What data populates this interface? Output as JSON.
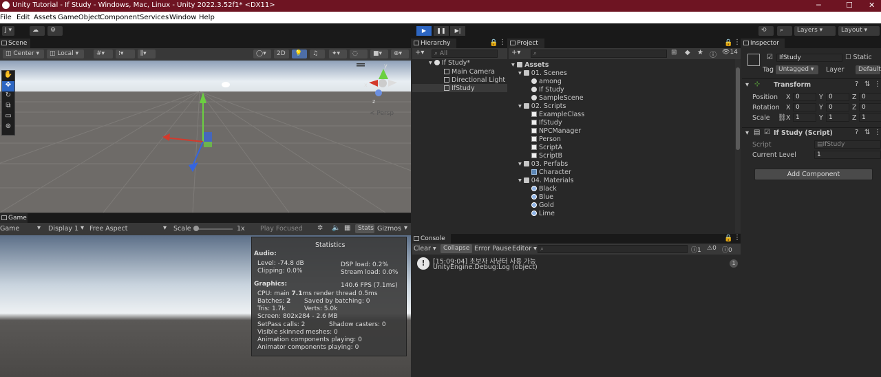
{
  "window": {
    "title": "Unity Tutorial - If Study - Windows, Mac, Linux - Unity 2022.3.52f1* <DX11>",
    "min": "─",
    "max": "☐",
    "close": "✕"
  },
  "menu": [
    "File",
    "Edit",
    "Assets",
    "GameObject",
    "Component",
    "Services",
    "Window",
    "Help"
  ],
  "toolbar": {
    "account": "J ▾",
    "layers": "Layers",
    "layout": "Layout"
  },
  "scene": {
    "tab": "Scene",
    "center": "Center",
    "local": "Local",
    "mode2d": "2D",
    "persp": "< Persp",
    "gizmo_x": "x",
    "gizmo_y": "y",
    "gizmo_z": "z"
  },
  "game": {
    "tab": "Game",
    "mode": "Game",
    "display": "Display 1",
    "aspect": "Free Aspect",
    "scale_label": "Scale",
    "scale_value": "1x",
    "play_focused": "Play Focused",
    "stats": "Stats",
    "gizmos": "Gizmos"
  },
  "stats": {
    "title": "Statistics",
    "audio_header": "Audio:",
    "level": "Level: -74.8 dB",
    "clipping": "Clipping: 0.0%",
    "dsp": "DSP load: 0.2%",
    "stream": "Stream load: 0.0%",
    "graphics_header": "Graphics:",
    "fps": "140.6 FPS (7.1ms)",
    "cpu_pre": "CPU: main ",
    "cpu_main": "7.1",
    "cpu_post": "ms  render thread 0.5ms",
    "batches_pre": "Batches: ",
    "batches_val": "2",
    "saved": "Saved by batching: 0",
    "tris": "Tris: 1.7k",
    "verts": "Verts: 5.0k",
    "screen": "Screen: 802x284 - 2.6 MB",
    "setpass": "SetPass calls: 2",
    "shadow": "Shadow casters: 0",
    "skinned": "Visible skinned meshes: 0",
    "anim": "Animation components playing: 0",
    "animator": "Animator components playing: 0"
  },
  "hierarchy": {
    "tab": "Hierarchy",
    "search": "All",
    "scene": "If Study*",
    "items": [
      "Main Camera",
      "Directional Light",
      "IfStudy"
    ]
  },
  "project": {
    "tab": "Project",
    "count": "14",
    "assets": "Assets",
    "tree": [
      {
        "label": "01. Scenes",
        "type": "folder",
        "depth": 1
      },
      {
        "label": "among",
        "type": "unity",
        "depth": 2
      },
      {
        "label": "If Study",
        "type": "unity",
        "depth": 2
      },
      {
        "label": "SampleScene",
        "type": "unity",
        "depth": 2
      },
      {
        "label": "02. Scripts",
        "type": "folder",
        "depth": 1
      },
      {
        "label": "ExampleClass",
        "type": "script",
        "depth": 2
      },
      {
        "label": "IfStudy",
        "type": "script",
        "depth": 2
      },
      {
        "label": "NPCManager",
        "type": "script",
        "depth": 2
      },
      {
        "label": "Person",
        "type": "script",
        "depth": 2
      },
      {
        "label": "ScriptA",
        "type": "script",
        "depth": 2
      },
      {
        "label": "ScriptB",
        "type": "script",
        "depth": 2
      },
      {
        "label": "03. Perfabs",
        "type": "folder",
        "depth": 1
      },
      {
        "label": "Character",
        "type": "cube",
        "depth": 2
      },
      {
        "label": "04. Materials",
        "type": "folder",
        "depth": 1
      },
      {
        "label": "Black",
        "type": "mat",
        "depth": 2
      },
      {
        "label": "Blue",
        "type": "mat",
        "depth": 2
      },
      {
        "label": "Gold",
        "type": "mat",
        "depth": 2
      },
      {
        "label": "Lime",
        "type": "mat",
        "depth": 2
      }
    ]
  },
  "console": {
    "tab": "Console",
    "clear": "Clear",
    "collapse": "Collapse",
    "error_pause": "Error Pause",
    "editor": "Editor",
    "count_info": "1",
    "count_warn": "0",
    "count_err": "0",
    "log_line1": "[15:09:04] 초보자 사냥터 사용 가능",
    "log_line2": "UnityEngine.Debug:Log (object)",
    "log_count": "1"
  },
  "inspector": {
    "tab": "Inspector",
    "name": "IfStudy",
    "static": "Static",
    "tag_label": "Tag",
    "tag": "Untagged",
    "layer_label": "Layer",
    "layer": "Default",
    "transform": "Transform",
    "position": "Position",
    "rotation": "Rotation",
    "scale": "Scale",
    "pos": [
      "0",
      "0",
      "0"
    ],
    "rot": [
      "0",
      "0",
      "0"
    ],
    "scl": [
      "1",
      "1",
      "1"
    ],
    "x": "X",
    "y": "Y",
    "z": "Z",
    "script_comp": "If Study (Script)",
    "script_label": "Script",
    "script_value": "IfStudy",
    "level_label": "Current Level",
    "level_value": "1",
    "add_component": "Add Component"
  }
}
